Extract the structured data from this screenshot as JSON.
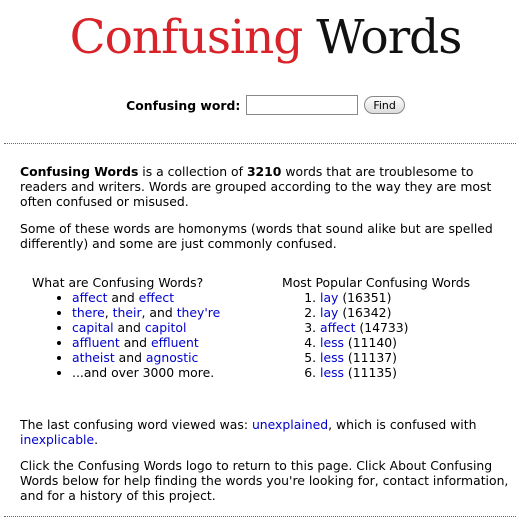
{
  "logo": {
    "part1": "Confusing",
    "part2": "Words"
  },
  "search": {
    "label": "Confusing word:",
    "value": "",
    "button": "Find"
  },
  "intro": {
    "brand": "Confusing Words",
    "text1": " is a collection of ",
    "count": "3210",
    "text2": " words that are troublesome to readers and writers. Words are grouped according to the way they are most often confused or misused."
  },
  "intro2": "Some of these words are homonyms (words that sound alike but are spelled differently) and some are just commonly confused.",
  "left": {
    "title": "What are Confusing Words?",
    "items": [
      {
        "a": "affect",
        "sep": " and ",
        "b": "effect"
      },
      {
        "a": "there",
        "s1": ", ",
        "b": "their",
        "s2": ", and ",
        "c": "they're"
      },
      {
        "a": "capital",
        "sep": " and ",
        "b": "capitol"
      },
      {
        "a": "affluent",
        "sep": " and ",
        "b": "effluent"
      },
      {
        "a": "atheist",
        "sep": " and ",
        "b": "agnostic"
      }
    ],
    "more": "...and over 3000 more."
  },
  "right": {
    "title": "Most Popular Confusing Words",
    "items": [
      {
        "word": "lay",
        "count": " (16351)"
      },
      {
        "word": "lay",
        "count": " (16342)"
      },
      {
        "word": "affect",
        "count": " (14733)"
      },
      {
        "word": "less",
        "count": " (11140)"
      },
      {
        "word": "less",
        "count": " (11137)"
      },
      {
        "word": "less",
        "count": " (11135)"
      }
    ]
  },
  "last": {
    "prefix": "The last confusing word viewed was: ",
    "word": "unexplained",
    "middle": ", which is confused with ",
    "confused": "inexplicable",
    "suffix": "."
  },
  "footer": "Click the Confusing Words logo to return to this page. Click About Confusing Words below for help finding the words you're looking for, contact information, and for a history of this project."
}
